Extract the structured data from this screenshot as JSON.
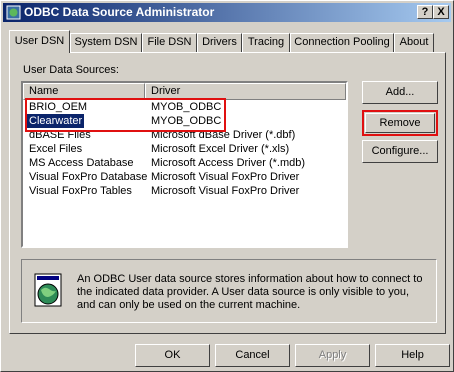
{
  "window": {
    "title": "ODBC Data Source Administrator",
    "help_label": "?",
    "close_label": "X"
  },
  "tabs": [
    {
      "label": "User DSN",
      "active": true
    },
    {
      "label": "System DSN"
    },
    {
      "label": "File DSN"
    },
    {
      "label": "Drivers"
    },
    {
      "label": "Tracing"
    },
    {
      "label": "Connection Pooling"
    },
    {
      "label": "About"
    }
  ],
  "user_dsn": {
    "list_label": "User Data Sources:",
    "columns": [
      "Name",
      "Driver"
    ],
    "rows": [
      {
        "name": "BRIO_OEM",
        "driver": "MYOB_ODBC"
      },
      {
        "name": "Clearwater",
        "driver": "MYOB_ODBC",
        "selected": true
      },
      {
        "name": "dBASE Files",
        "driver": "Microsoft dBase Driver (*.dbf)"
      },
      {
        "name": "Excel Files",
        "driver": "Microsoft Excel Driver (*.xls)"
      },
      {
        "name": "MS Access Database",
        "driver": "Microsoft Access Driver (*.mdb)"
      },
      {
        "name": "Visual FoxPro Database",
        "driver": "Microsoft Visual FoxPro Driver"
      },
      {
        "name": "Visual FoxPro Tables",
        "driver": "Microsoft Visual FoxPro Driver"
      }
    ],
    "buttons": {
      "add": "Add...",
      "remove": "Remove",
      "configure": "Configure..."
    },
    "info_text": "An ODBC User data source stores information about how to connect to the indicated data provider.  A User data source is only visible to you, and can only be used on the current machine."
  },
  "footer": {
    "ok": "OK",
    "cancel": "Cancel",
    "apply": "Apply",
    "help": "Help"
  },
  "colors": {
    "titlebar_start": "#0a246a",
    "highlight_box": "#e01010",
    "selection": "#0a246a"
  }
}
